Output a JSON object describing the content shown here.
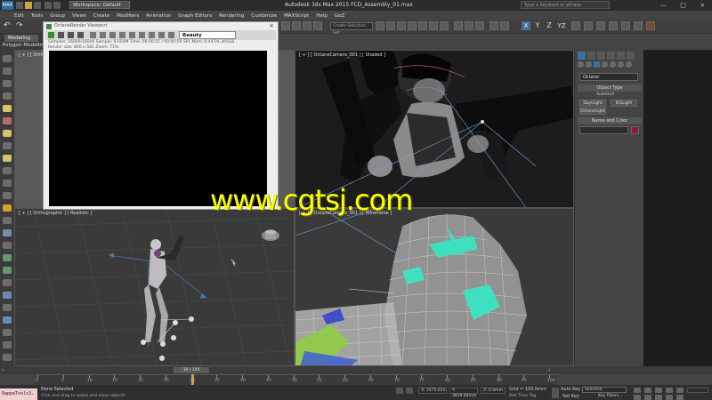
{
  "titlebar": {
    "app_logo": "MAX",
    "workspace": "Workspace: Default",
    "title": "Autodesk 3ds Max 2015     FCD_Assembly_01.max",
    "search_placeholder": "Type a keyword or phrase",
    "window_controls": [
      "—",
      "□",
      "×"
    ]
  },
  "menu": [
    "Edit",
    "Tools",
    "Group",
    "Views",
    "Create",
    "Modifiers",
    "Animation",
    "Graph Editors",
    "Rendering",
    "Customize",
    "MAXScript",
    "Help",
    "GoZ"
  ],
  "toolbar": {
    "selection_set_placeholder": "Create Selection Set",
    "axis_labels": [
      "X",
      "Y",
      "Z",
      "YZ"
    ]
  },
  "ribbon": {
    "tab_modeling": "Modeling",
    "tab_polygon": "Polygon Modeling"
  },
  "render_window": {
    "title": "OctaneRender Viewport",
    "render_pass": "Beauty",
    "stats_line1": "Samples: 16000/16000   Sample: 0.050M   Time: 00:00:55 / 00:00:59   SPL Mem: 0.447/4.365GB",
    "stats_line2": "Render size: 800 x 581   Zoom: 71%"
  },
  "viewports": {
    "top_left": "[ + ] [ Orthographic ]",
    "top_right": "[ + ] [ OctaneCamera_001 ] [ Shaded ]",
    "bottom_left": "[ + ] [ Orthographic ] [ Realistic ]",
    "bottom_right": "[ + ] [ OctaneCamera_001 ] [ Wireframe ]"
  },
  "watermark": "www.cgtsj.com",
  "command_panel": {
    "category": "Octane",
    "object_type_header": "Object Type",
    "autogrid": "AutoGrid",
    "buttons": [
      "DaylLight",
      "IESLight",
      "OctaneLight"
    ],
    "name_color_header": "Name and Color",
    "object_color": "#8e1a3a"
  },
  "timeline": {
    "frame_readout": "30 / 100",
    "current_frame": 30,
    "total_frames": 100,
    "ticks": [
      "0",
      "5",
      "10",
      "15",
      "20",
      "25",
      "30",
      "35",
      "40",
      "45",
      "50",
      "55",
      "60",
      "65",
      "70",
      "75",
      "80",
      "85",
      "90",
      "95",
      "100"
    ]
  },
  "status": {
    "maxscript": "RappaTools3.",
    "selection": "None Selected",
    "prompt": "Click and drag to select and move objects",
    "x": "X: 2475.031",
    "y": "Y: 3819.84mm",
    "z": "Z: 0.0mm",
    "grid": "Grid = 100.0mm",
    "add_time_tag": "Add Time Tag",
    "auto_key": "Auto Key",
    "selected_dropdown": "Selected",
    "set_key": "Set Key",
    "key_filters": "Key Filters..."
  }
}
